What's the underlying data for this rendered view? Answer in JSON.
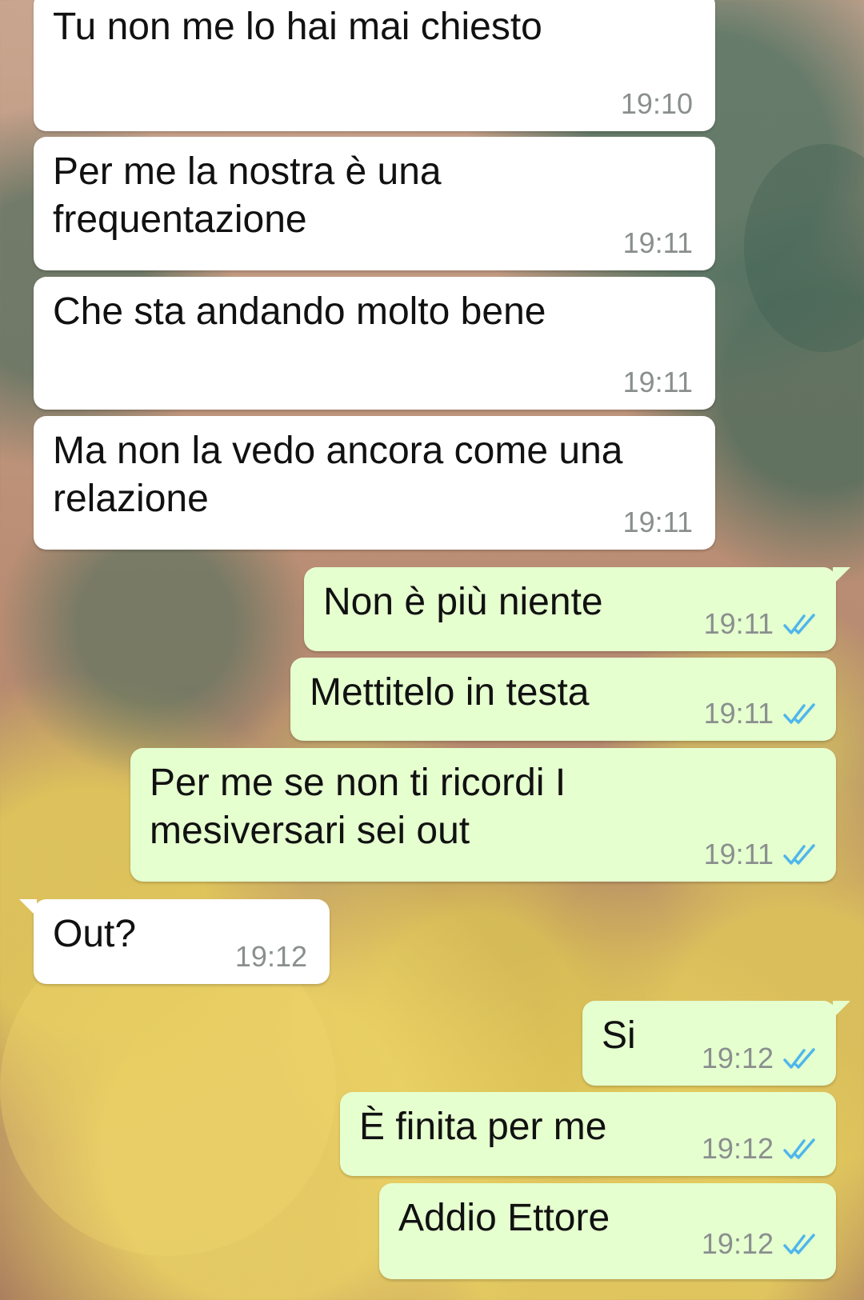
{
  "colors": {
    "incoming_bubble": "#ffffff",
    "outgoing_bubble": "#e5ffcf",
    "read_ticks": "#4fb6ec",
    "timestamp": "#8a8f8e"
  },
  "messages": [
    {
      "text": "Tu non me lo hai mai chiesto",
      "time": "19:10",
      "direction": "in"
    },
    {
      "text": "Per me la nostra è una\nfrequentazione",
      "time": "19:11",
      "direction": "in"
    },
    {
      "text": "Che sta andando molto bene",
      "time": "19:11",
      "direction": "in"
    },
    {
      "text": "Ma non la vedo ancora come una\nrelazione",
      "time": "19:11",
      "direction": "in"
    },
    {
      "text": "Non è più niente",
      "time": "19:11",
      "direction": "out",
      "status_icon": "double-check-read-icon"
    },
    {
      "text": "Mettitelo in testa",
      "time": "19:11",
      "direction": "out",
      "status_icon": "double-check-read-icon"
    },
    {
      "text": "Per me se non ti ricordi I\nmesiversari sei out",
      "time": "19:11",
      "direction": "out",
      "status_icon": "double-check-read-icon"
    },
    {
      "text": "Out?",
      "time": "19:12",
      "direction": "in"
    },
    {
      "text": "Si",
      "time": "19:12",
      "direction": "out",
      "status_icon": "double-check-read-icon"
    },
    {
      "text": "È finita per me",
      "time": "19:12",
      "direction": "out",
      "status_icon": "double-check-read-icon"
    },
    {
      "text": "Addio Ettore",
      "time": "19:12",
      "direction": "out",
      "status_icon": "double-check-read-icon"
    }
  ]
}
